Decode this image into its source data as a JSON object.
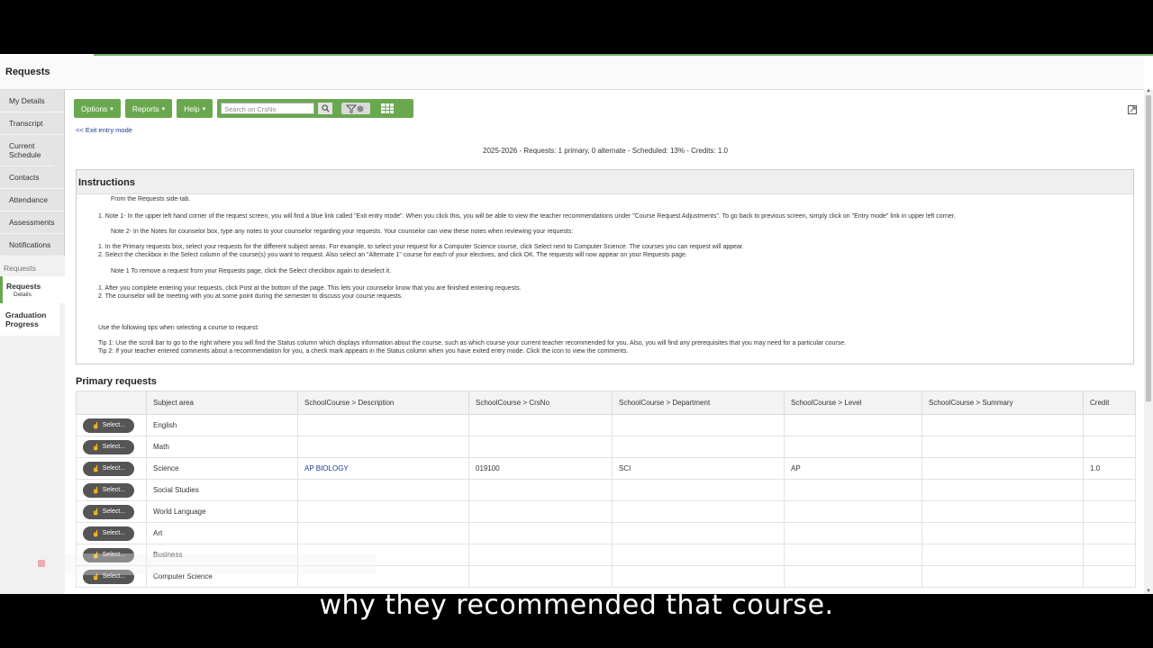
{
  "page": {
    "title": "Requests"
  },
  "sidebar": {
    "items": [
      "My Details",
      "Transcript",
      "Current Schedule",
      "Contacts",
      "Attendance",
      "Assessments",
      "Notifications"
    ],
    "section_label": "Requests",
    "active": {
      "label": "Requests",
      "sub": "Details"
    },
    "graduation": "Graduation Progress"
  },
  "toolbar": {
    "options": "Options",
    "reports": "Reports",
    "help": "Help",
    "search_placeholder": "Search on CrsNo"
  },
  "exit_link": "<< Exit entry mode",
  "summary": "2025-2026 - Requests: 1 primary, 0 alternate - Scheduled: 13% - Credits: 1.0",
  "instructions": {
    "title": "Instructions",
    "lines": [
      "From the Requests side-tab.",
      "1. Note 1- In the upper left hand corner of the request screen, you will find a blue link called \"Exit entry mode\". When you click this, you will be able to view the teacher recommendations under \"Course Request Adjustments\". To go back to previous screen, simply click on \"Entry mode\" link in upper left corner.",
      "Note 2- In the Notes for counselor box, type any notes to your counselor regarding your requests. Your counselor can view these notes when reviewing your requests:",
      "1. In the Primary requests box, select your requests for the different subject areas. For example, to select your request for a Computer Science course, click Select next to Computer Science. The courses you can request will appear.",
      "2. Select the checkbox in the Select column of the course(s) you want to request. Also select an \"Alternate 1\" course for each of your electives, and click OK. The requests will now appear on your Requests page.",
      "Note 1 To remove a request from your Requests page, click the Select checkbox again to deselect it.",
      "1. After you complete entering your requests, click Post at the bottom of the page. This lets your counselor know that you are finished entering requests.",
      "2. The counselor will be meeting with you at some point during the semester to discuss your course requests.",
      "Use the following tips when selecting a course to request:",
      "Tip 1: Use the scroll bar to go to the right where you will find the Status column which displays information about the course, such as which course your current teacher recommended for you. Also, you will find any prerequisites that you may need for a particular course.",
      "Tip 2: If your teacher entered comments about a recommendation for you, a check mark appears in the Status column when you have exited entry mode. Click the icon to view the comments."
    ]
  },
  "primary": {
    "title": "Primary requests",
    "columns": [
      "",
      "Subject area",
      "SchoolCourse > Description",
      "SchoolCourse > CrsNo",
      "SchoolCourse > Department",
      "SchoolCourse > Level",
      "SchoolCourse > Summary",
      "Credit"
    ],
    "select_label": "Select...",
    "rows": [
      {
        "subject": "English",
        "desc": "",
        "crsno": "",
        "dept": "",
        "level": "",
        "summary": "",
        "credit": ""
      },
      {
        "subject": "Math",
        "desc": "",
        "crsno": "",
        "dept": "",
        "level": "",
        "summary": "",
        "credit": ""
      },
      {
        "subject": "Science",
        "desc": "AP BIOLOGY",
        "crsno": "019100",
        "dept": "SCI",
        "level": "AP",
        "summary": "",
        "credit": "1.0"
      },
      {
        "subject": "Social Studies",
        "desc": "",
        "crsno": "",
        "dept": "",
        "level": "",
        "summary": "",
        "credit": ""
      },
      {
        "subject": "World Language",
        "desc": "",
        "crsno": "",
        "dept": "",
        "level": "",
        "summary": "",
        "credit": ""
      },
      {
        "subject": "Art",
        "desc": "",
        "crsno": "",
        "dept": "",
        "level": "",
        "summary": "",
        "credit": ""
      },
      {
        "subject": "Business",
        "desc": "",
        "crsno": "",
        "dept": "",
        "level": "",
        "summary": "",
        "credit": ""
      },
      {
        "subject": "Computer Science",
        "desc": "",
        "crsno": "",
        "dept": "",
        "level": "",
        "summary": "",
        "credit": ""
      }
    ]
  },
  "caption": "why they recommended that course.",
  "colors": {
    "accent": "#6aa84f",
    "link": "#1a3d8f"
  }
}
